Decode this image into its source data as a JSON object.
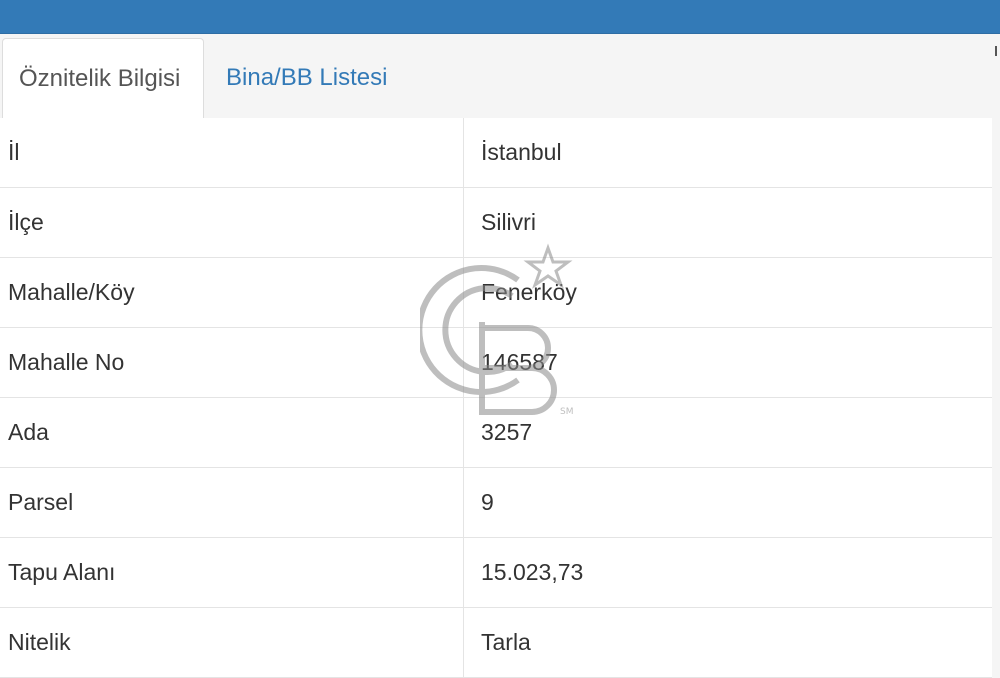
{
  "tabs": [
    {
      "label": "Öznitelik Bilgisi",
      "active": true
    },
    {
      "label": "Bina/BB Listesi",
      "active": false
    }
  ],
  "attributes": [
    {
      "key": "İl",
      "value": "İstanbul"
    },
    {
      "key": "İlçe",
      "value": "Silivri"
    },
    {
      "key": "Mahalle/Köy",
      "value": "Fenerköy"
    },
    {
      "key": "Mahalle No",
      "value": "146587"
    },
    {
      "key": "Ada",
      "value": "3257"
    },
    {
      "key": "Parsel",
      "value": "9"
    },
    {
      "key": "Tapu Alanı",
      "value": "15.023,73"
    },
    {
      "key": "Nitelik",
      "value": "Tarla"
    }
  ],
  "watermark": {
    "icon": "cb-logo-icon",
    "mark": "SM"
  },
  "colors": {
    "header": "#337ab7",
    "link": "#337ab7",
    "border": "#dddddd"
  }
}
